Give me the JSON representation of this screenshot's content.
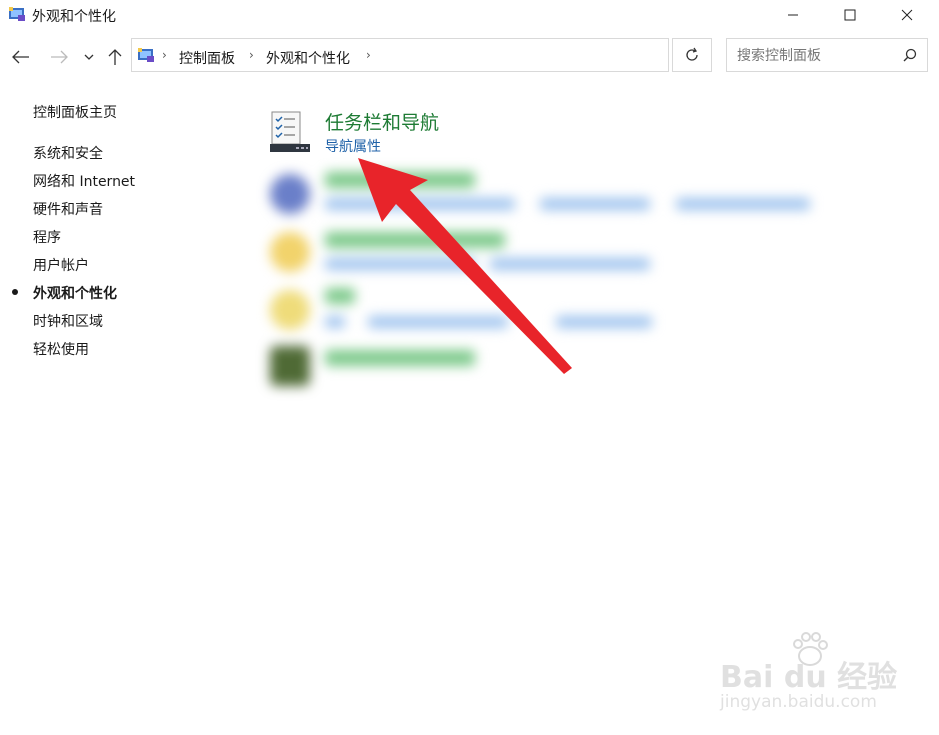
{
  "window": {
    "title": "外观和个性化"
  },
  "addressbar": {
    "crumbs": [
      "控制面板",
      "外观和个性化"
    ]
  },
  "search": {
    "placeholder": "搜索控制面板"
  },
  "sidebar": {
    "items": [
      {
        "label": "控制面板主页"
      },
      {
        "label": "系统和安全"
      },
      {
        "label": "网络和 Internet"
      },
      {
        "label": "硬件和声音"
      },
      {
        "label": "程序"
      },
      {
        "label": "用户帐户"
      },
      {
        "label": "外观和个性化",
        "active": true
      },
      {
        "label": "时钟和区域"
      },
      {
        "label": "轻松使用"
      }
    ]
  },
  "main": {
    "category": {
      "title": "任务栏和导航",
      "link": "导航属性"
    }
  },
  "colors": {
    "category_title": "#1e7b34",
    "link": "#1f62a8",
    "annotation_arrow": "#e8242a"
  },
  "watermark": {
    "brand": "Bai  du 经验",
    "url": "jingyan.baidu.com"
  }
}
